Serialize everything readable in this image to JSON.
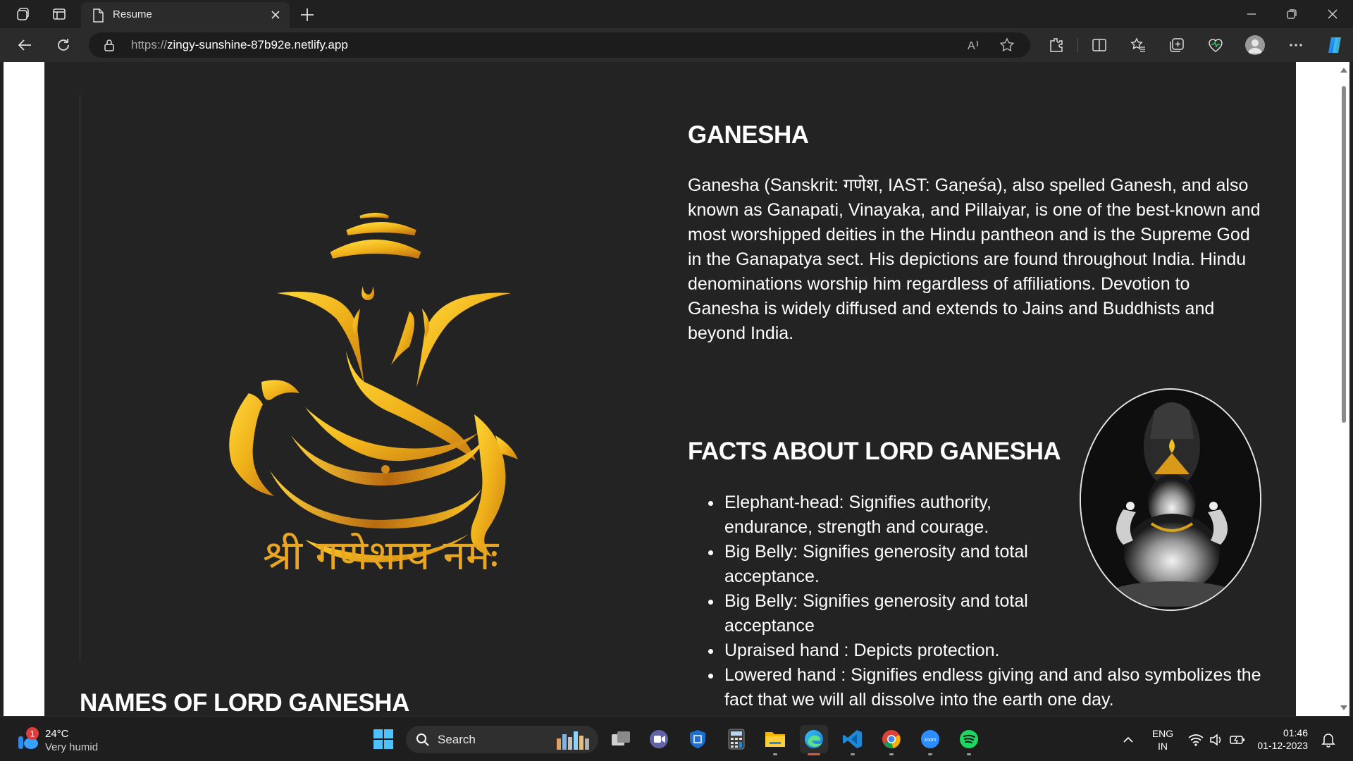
{
  "browser": {
    "tab_title": "Resume",
    "url_protocol": "https://",
    "url_host": "zingy-sunshine-87b92e.netlify.app"
  },
  "page": {
    "heading_ganesha": "GANESHA",
    "intro_text": "Ganesha (Sanskrit: गणेश, IAST: Gaṇeśa), also spelled Ganesh, and also known as Ganapati, Vinayaka, and Pillaiyar, is one of the best-known and most worshipped deities in the Hindu pantheon and is the Supreme God in the Ganapatya sect. His depictions are found throughout India. Hindu denominations worship him regardless of affiliations. Devotion to Ganesha is widely diffused and extends to Jains and Buddhists and beyond India.",
    "heading_facts": "FACTS ABOUT LORD GANESHA",
    "facts": [
      "Elephant-head: Signifies authority, endurance, strength and courage.",
      "Big Belly: Signifies generosity and total acceptance.",
      "Big Belly: Signifies generosity and total acceptance",
      "Upraised hand : Depicts protection.",
      "Lowered hand : Signifies endless giving and and also symbolizes the fact that we will all dissolve into the earth one day."
    ],
    "heading_names": "NAMES OF LORD GANESHA",
    "art_caption": "श्री गणेशाय नमः"
  },
  "taskbar": {
    "weather_badge": "1",
    "temperature": "24°C",
    "condition": "Very humid",
    "search_label": "Search",
    "lang_line1": "ENG",
    "lang_line2": "IN",
    "time": "01:46",
    "date": "01-12-2023"
  },
  "colors": {
    "page_bg": "#232323",
    "gold": "#f2b81a",
    "chrome_bg": "#202020",
    "toolbar_bg": "#2b2b2b"
  }
}
